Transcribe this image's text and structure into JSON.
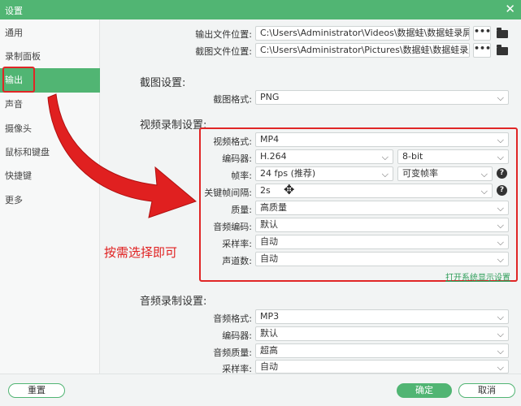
{
  "window": {
    "title": "设置",
    "close_label": "✕"
  },
  "sidebar": {
    "items": [
      {
        "label": "通用",
        "active": false
      },
      {
        "label": "录制面板",
        "active": false
      },
      {
        "label": "输出",
        "active": true
      },
      {
        "label": "声音",
        "active": false
      },
      {
        "label": "摄像头",
        "active": false
      },
      {
        "label": "鼠标和键盘",
        "active": false
      },
      {
        "label": "快捷键",
        "active": false
      },
      {
        "label": "更多",
        "active": false
      }
    ]
  },
  "paths": {
    "output_label": "输出文件位置:",
    "output_value": "C:\\Users\\Administrator\\Videos\\数据蛙\\数据蛙录屏软件",
    "screenshot_label": "截图文件位置:",
    "screenshot_value": "C:\\Users\\Administrator\\Pictures\\数据蛙\\数据蛙录屏软件",
    "browse_label": "•••"
  },
  "screenshot_settings": {
    "title": "截图设置:",
    "format_label": "截图格式:",
    "format_value": "PNG"
  },
  "video_settings": {
    "title": "视频录制设置:",
    "format_label": "视频格式:",
    "format_value": "MP4",
    "encoder_label": "编码器:",
    "encoder_value": "H.264",
    "bitdepth_value": "8-bit",
    "framerate_label": "帧率:",
    "framerate_value": "24 fps (推荐)",
    "framerate_mode_value": "可变帧率",
    "keyframe_label": "关键帧间隔:",
    "keyframe_value": "2s",
    "quality_label": "质量:",
    "quality_value": "高质量",
    "audio_codec_label": "音频编码:",
    "audio_codec_value": "默认",
    "samplerate_label": "采样率:",
    "samplerate_value": "自动",
    "channels_label": "声道数:",
    "channels_value": "自动",
    "open_system_display": "打开系统显示设置"
  },
  "audio_settings": {
    "title": "音频录制设置:",
    "format_label": "音频格式:",
    "format_value": "MP3",
    "encoder_label": "编码器:",
    "encoder_value": "默认",
    "quality_label": "音频质量:",
    "quality_value": "超高",
    "samplerate_label": "采样率:",
    "samplerate_value": "自动"
  },
  "annotation": {
    "note": "按需选择即可",
    "colors": {
      "red": "#e02626"
    }
  },
  "footer": {
    "reset": "重置",
    "ok": "确定",
    "cancel": "取消"
  },
  "colors": {
    "accent": "#51b573"
  }
}
